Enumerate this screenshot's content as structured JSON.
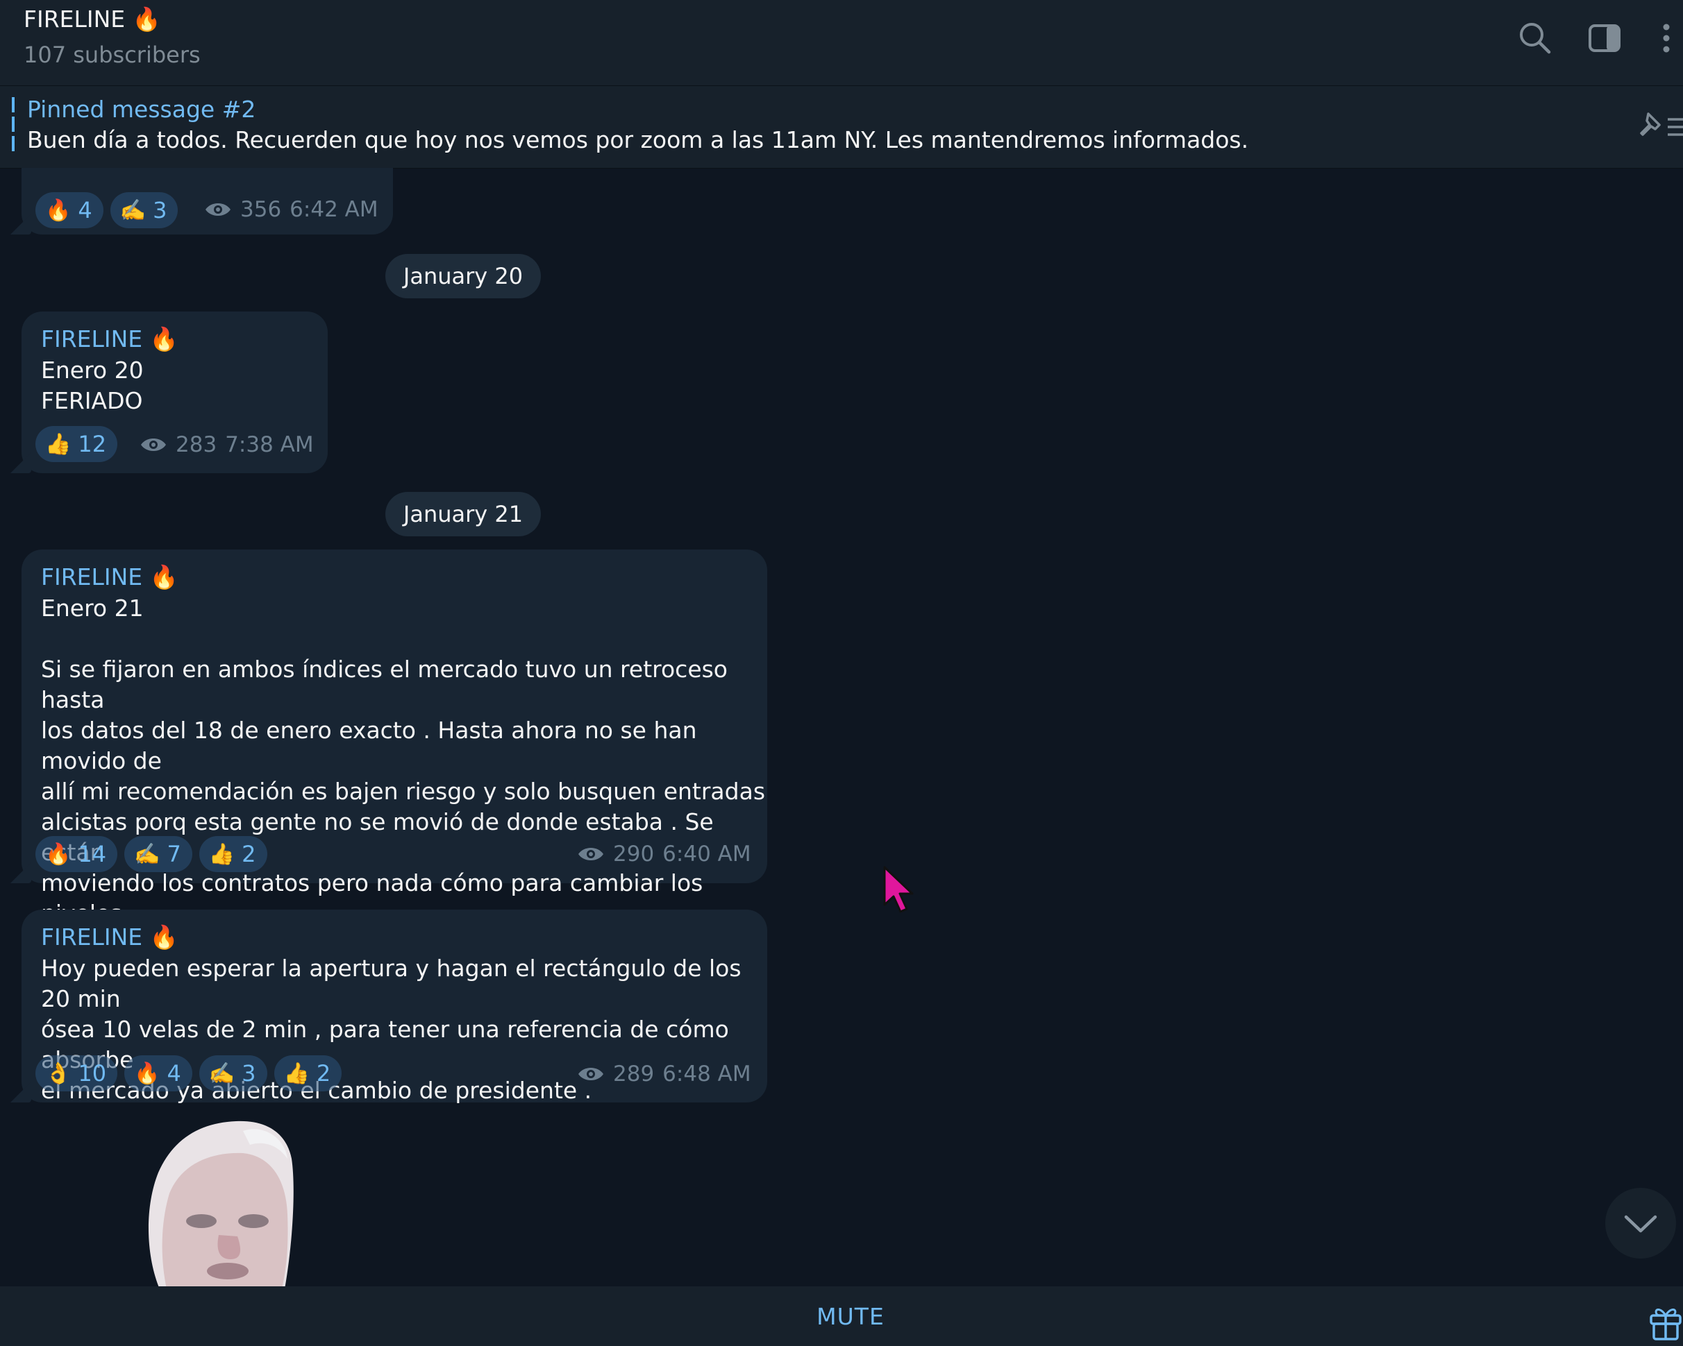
{
  "header": {
    "title": "FIRELINE 🔥",
    "subtitle": "107 subscribers"
  },
  "pinned": {
    "title": "Pinned message #2",
    "text": "Buen día a todos. Recuerden que hoy nos vemos por zoom a las 11am NY. Les mantendremos informados."
  },
  "messages": [
    {
      "reactions": [
        {
          "emoji": "🔥",
          "count": "4"
        },
        {
          "emoji": "✍️",
          "count": "3"
        }
      ],
      "views": "356",
      "time": "6:42 AM"
    },
    {
      "date": "January 20",
      "sender": "FIRELINE 🔥",
      "text": "Enero 20\nFERIADO",
      "reactions": [
        {
          "emoji": "👍",
          "count": "12"
        }
      ],
      "views": "283",
      "time": "7:38 AM"
    },
    {
      "date": "January 21",
      "sender": "FIRELINE 🔥",
      "text": "Enero 21\n\nSi se fijaron en ambos índices el mercado tuvo un retroceso hasta\nlos datos del 18 de enero exacto . Hasta ahora no se han movido de\nallí mi recomendación es bajen riesgo y solo busquen entradas\nalcistas porq esta gente no se movió de donde estaba . Se están\nmoviendo los contratos pero nada cómo para cambiar los niveles,\nestaré pendiente por si ocurre un cambio .",
      "reactions": [
        {
          "emoji": "🔥",
          "count": "14"
        },
        {
          "emoji": "✍️",
          "count": "7"
        },
        {
          "emoji": "👍",
          "count": "2"
        }
      ],
      "views": "290",
      "time": "6:40 AM"
    },
    {
      "sender": "FIRELINE 🔥",
      "text": "Hoy pueden esperar la apertura y hagan el rectángulo de los 20 min\nósea 10 velas de 2 min , para tener una referencia de cómo absorbe\nel mercado ya abierto el cambio de presidente .",
      "reactions": [
        {
          "emoji": "👌",
          "count": "10"
        },
        {
          "emoji": "🔥",
          "count": "4"
        },
        {
          "emoji": "✍️",
          "count": "3"
        },
        {
          "emoji": "👍",
          "count": "2"
        }
      ],
      "views": "289",
      "time": "6:48 AM"
    }
  ],
  "footer": {
    "mute_label": "MUTE"
  },
  "icons": {
    "header": [
      "search-icon",
      "sidebar-toggle-icon",
      "more-vertical-icon"
    ],
    "pinned": "pinned-list-icon",
    "views": "eye-icon",
    "scroll": "chevron-down-icon",
    "footer": "gift-icon"
  },
  "colors": {
    "background": "#0e1621",
    "panel": "#17212b",
    "bubble": "#182533",
    "accent": "#71baf2",
    "muted": "#6d7f8f",
    "cursor": "#e0179c"
  }
}
